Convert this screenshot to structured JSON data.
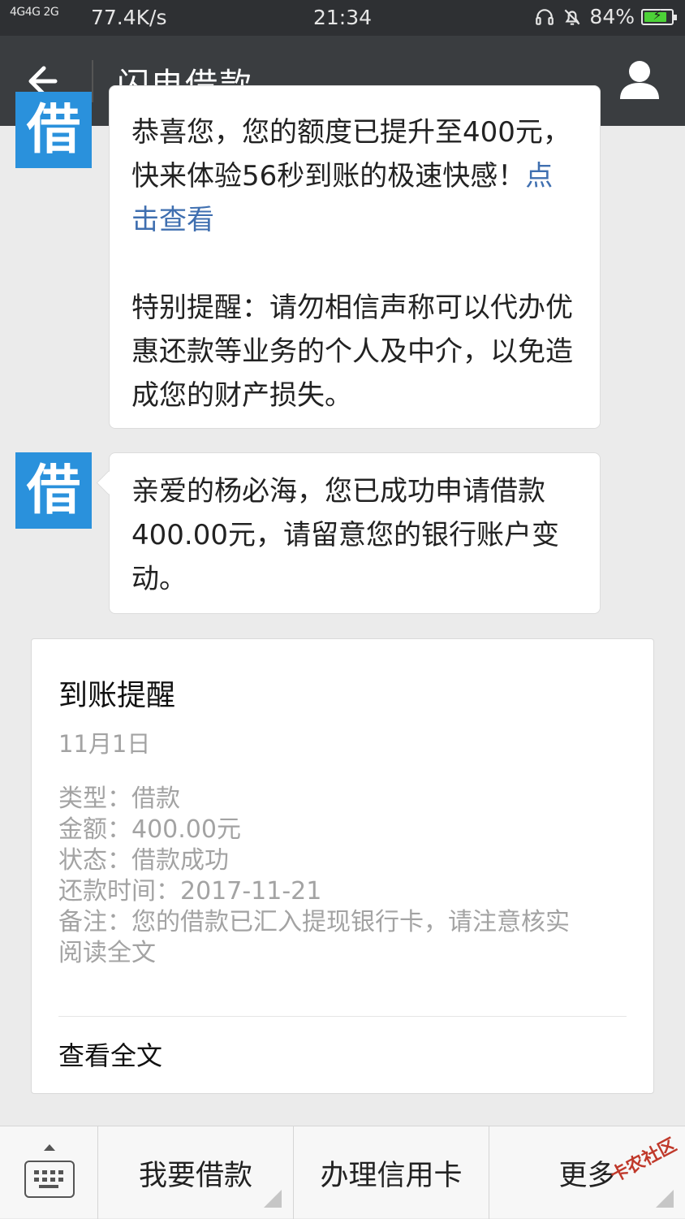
{
  "status_bar": {
    "signal": "4G4G 2G",
    "net_speed": "77.4K/s",
    "time": "21:34",
    "battery": "84%",
    "battery_level": 0.84
  },
  "header": {
    "title": "闪电借款"
  },
  "messages": [
    {
      "avatar_glyph": "借",
      "lines_top": "恭喜您，您的额度已提升至400元，",
      "line2": "快来体验56秒到账的极速快感！",
      "link_text": "点击查看",
      "reminder": "特别提醒：请勿相信声称可以代办优惠还款等业务的个人及中介，以免造成您的财产损失。"
    },
    {
      "avatar_glyph": "借",
      "text": "亲爱的杨必海，您已成功申请借款400.00元，请留意您的银行账户变动。"
    }
  ],
  "card": {
    "title": "到账提醒",
    "date": "11月1日",
    "type": "类型：借款",
    "amount": "金额：400.00元",
    "status": "状态：借款成功",
    "repay_time": "还款时间：2017-11-21",
    "note": "备注：您的借款已汇入提现银行卡，请注意核实",
    "read_all": "阅读全文",
    "view_full": "查看全文"
  },
  "bottom_menu": {
    "items": [
      "我要借款",
      "办理信用卡",
      "更多"
    ],
    "watermark": "卡农社区"
  },
  "colors": {
    "avatar_bg": "#2a91dc",
    "link": "#3f6fb0",
    "header_bg": "#3a3d40"
  }
}
